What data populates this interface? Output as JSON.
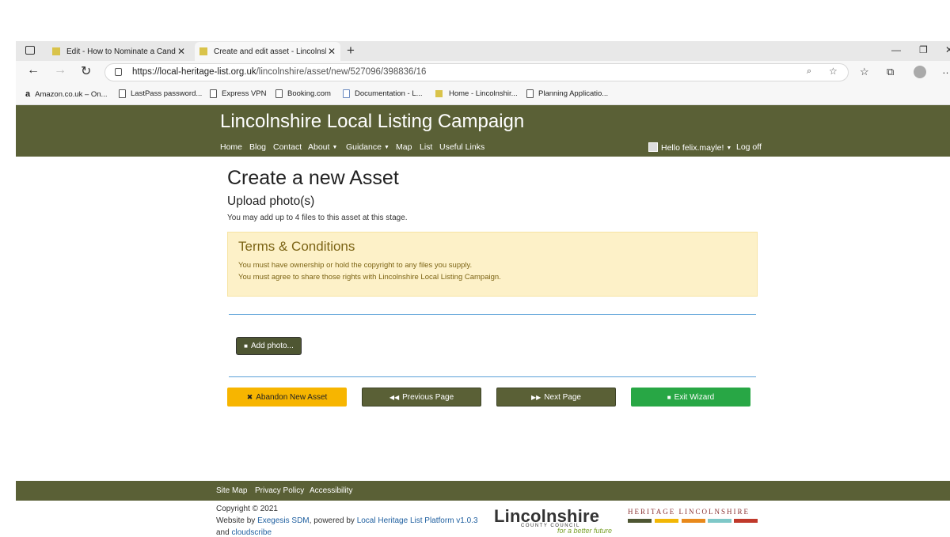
{
  "browser": {
    "tabs": [
      {
        "title": "Edit - How to Nominate a Candid"
      },
      {
        "title": "Create and edit asset - Lincolnsh"
      }
    ],
    "url_host": "https://local-heritage-list.org.uk",
    "url_path": "/lincolnshire/asset/new/527096/398836/16",
    "bookmarks": [
      "Amazon.co.uk – On...",
      "LastPass password...",
      "Express VPN",
      "Booking.com",
      "Documentation - L...",
      "Home - Lincolnshir...",
      "Planning Applicatio..."
    ]
  },
  "site": {
    "title": "Lincolnshire Local Listing Campaign",
    "nav": [
      "Home",
      "Blog",
      "Contact",
      "About",
      "Guidance",
      "Map",
      "List",
      "Useful Links"
    ],
    "user_greeting": "Hello felix.mayle!",
    "logoff": "Log off"
  },
  "main": {
    "heading": "Create a new Asset",
    "subheading": "Upload photo(s)",
    "intro": "You may add up to 4 files to this asset at this stage.",
    "terms_title": "Terms & Conditions",
    "terms_line1": "You must have ownership or hold the copyright to any files you supply.",
    "terms_line2": "You must agree to share those rights with Lincolnshire Local Listing Campaign.",
    "add_photo": "Add photo...",
    "abandon": "Abandon New Asset",
    "previous": "Previous Page",
    "next": "Next Page",
    "exit": "Exit Wizard"
  },
  "footer": {
    "links": [
      "Site Map",
      "Privacy Policy",
      "Accessibility"
    ],
    "copyright": "Copyright © 2021",
    "website_by": "Website by ",
    "exegesis": "Exegesis SDM",
    "powered_by": ", powered by ",
    "platform": "Local Heritage List Platform v1.0.3",
    "and": "and ",
    "cloudscribe": "cloudscribe",
    "lcc_logo": "Lincolnshire",
    "lcc_sub": "COUNTY COUNCIL",
    "lcc_tag": "for a better future",
    "hl_logo": "HERITAGE LINCOLNSHIRE"
  },
  "colors": {
    "header_bg": "#5a6036",
    "abandon": "#f7b500",
    "exit": "#28a745",
    "terms_bg": "#fdf1c8"
  }
}
